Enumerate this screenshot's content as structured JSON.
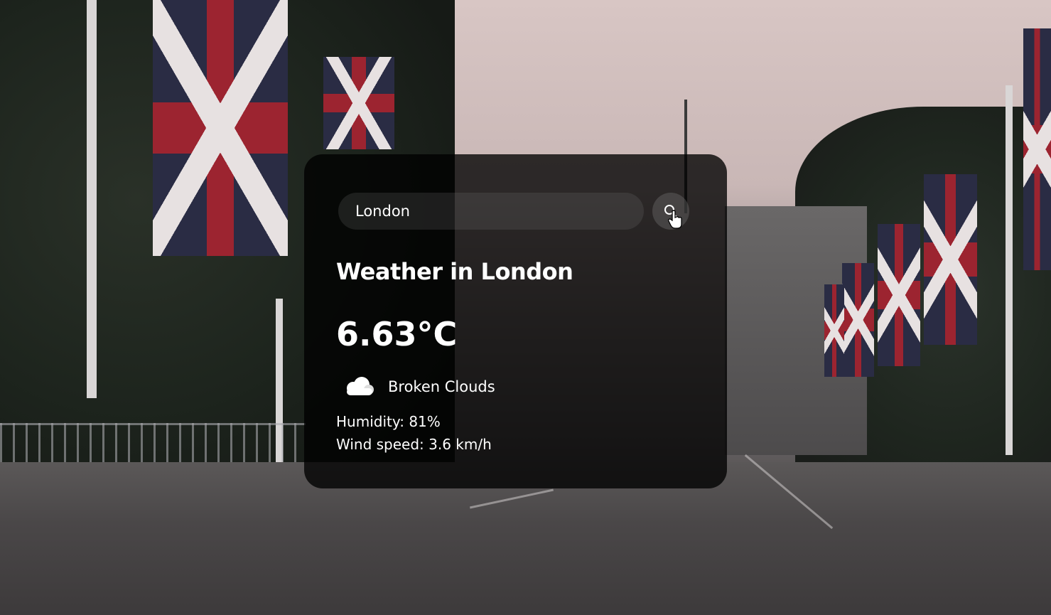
{
  "search": {
    "value": "London",
    "button_icon": "search-icon"
  },
  "weather": {
    "title": "Weather in London",
    "temperature": "6.63°C",
    "condition_icon": "cloud-icon",
    "description": "Broken Clouds",
    "humidity": "Humidity: 81%",
    "wind": "Wind speed: 3.6 km/h"
  },
  "colors": {
    "card_background": "#000000",
    "text": "#ffffff",
    "flag_red": "#9c2430",
    "flag_blue": "#2a2c44"
  }
}
